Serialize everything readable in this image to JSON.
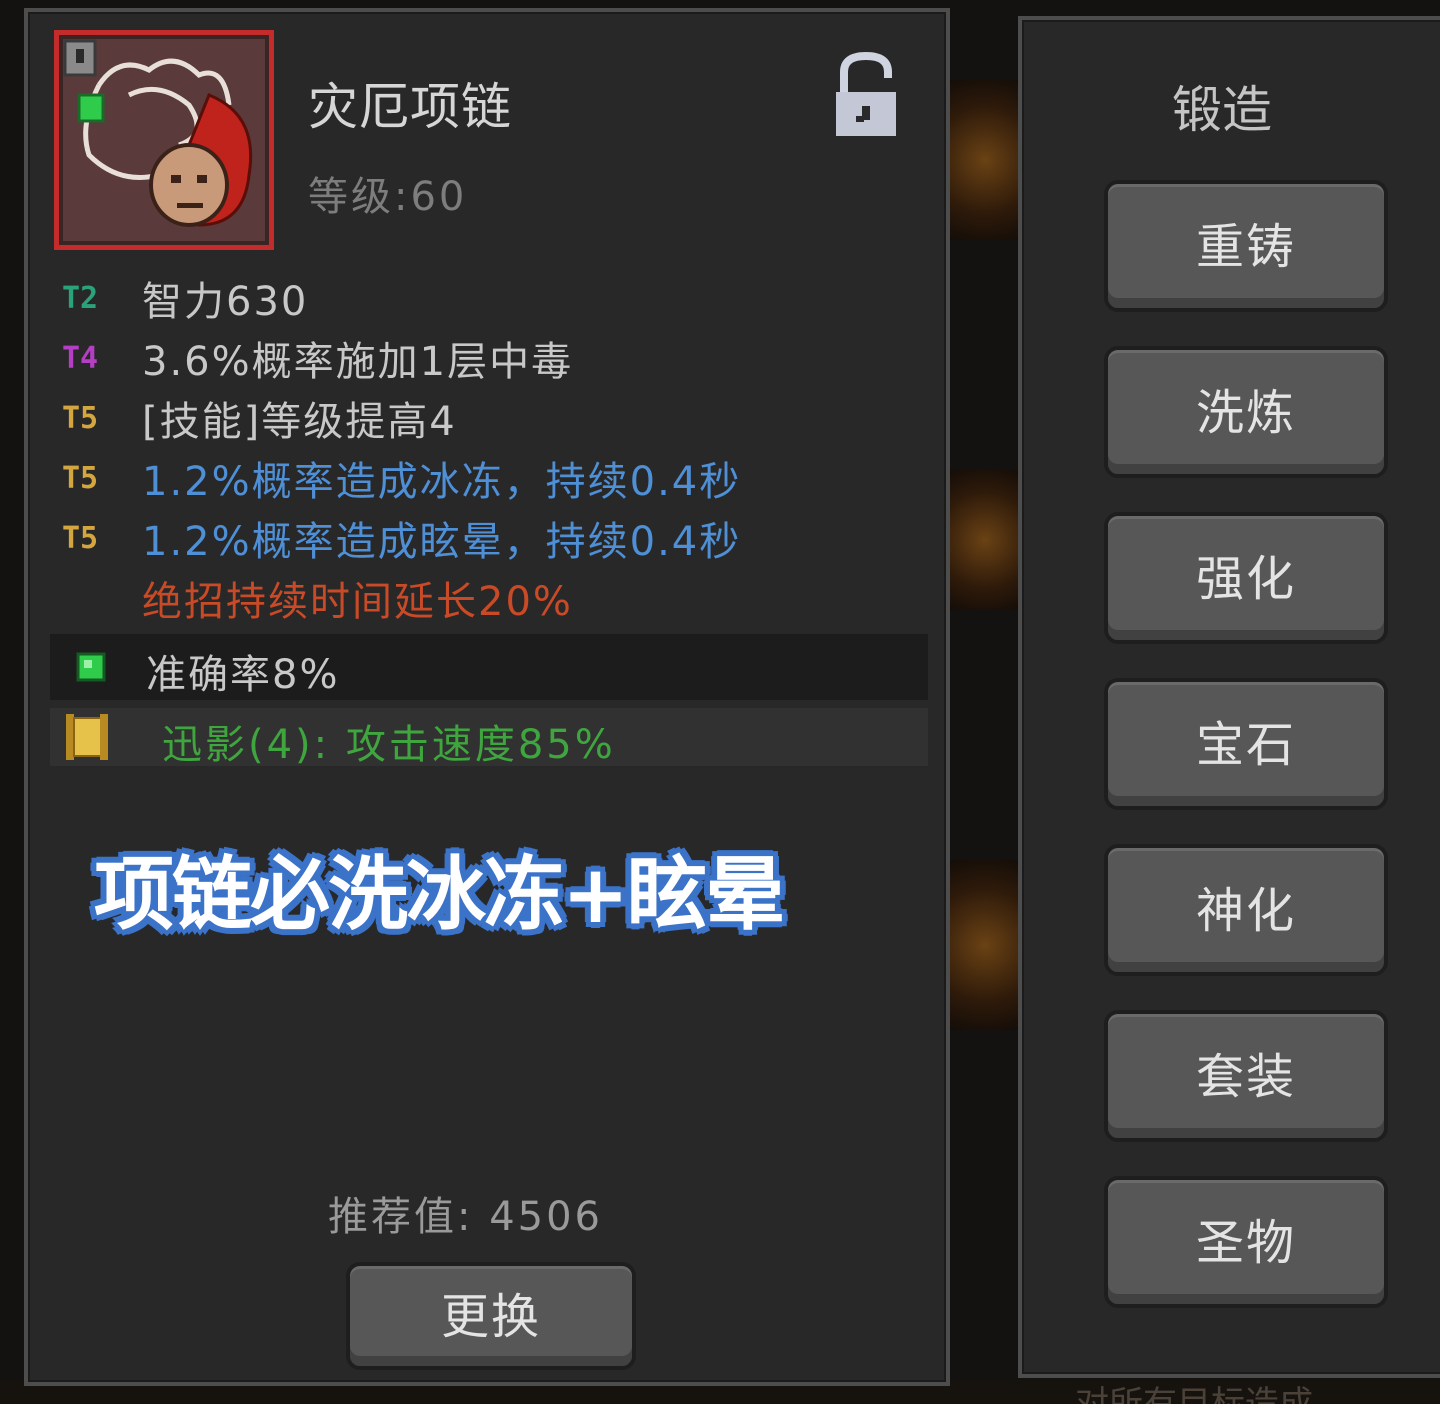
{
  "item": {
    "name": "灾厄项链",
    "level": "等级:60",
    "icon": "necklace-with-skull-icon",
    "locked": false
  },
  "affixes": [
    {
      "tier": "T2",
      "tier_color": "#2aa37a",
      "text": "智力630",
      "text_color": "#c8c8c8"
    },
    {
      "tier": "T4",
      "tier_color": "#b43fc4",
      "text": "3.6%概率施加1层中毒",
      "text_color": "#c8c8c8"
    },
    {
      "tier": "T5",
      "tier_color": "#d4a640",
      "text": "[技能]等级提高4",
      "text_color": "#c8c8c8"
    },
    {
      "tier": "T5",
      "tier_color": "#d4a640",
      "text": "1.2%概率造成冰冻，持续0.4秒",
      "text_color": "#4f8fd6"
    },
    {
      "tier": "T5",
      "tier_color": "#d4a640",
      "text": "1.2%概率造成眩晕，持续0.4秒",
      "text_color": "#4f8fd6"
    },
    {
      "tier": "",
      "tier_color": "#d4a640",
      "text": "绝招持续时间延长20%",
      "text_color": "#c84a26"
    }
  ],
  "gem": {
    "icon": "green-gem-icon",
    "text": "准确率8%"
  },
  "set_bonus": {
    "icon": "scroll-icon",
    "text": "迅影(4): 攻击速度85%"
  },
  "caption": "项链必洗冰冻+眩晕",
  "score": "推荐值: 4506",
  "replace_label": "更换",
  "forge": {
    "title": "锻造",
    "buttons": [
      "重铸",
      "洗炼",
      "强化",
      "宝石",
      "神化",
      "套装",
      "圣物"
    ]
  },
  "background_text": "对所有目标造成"
}
